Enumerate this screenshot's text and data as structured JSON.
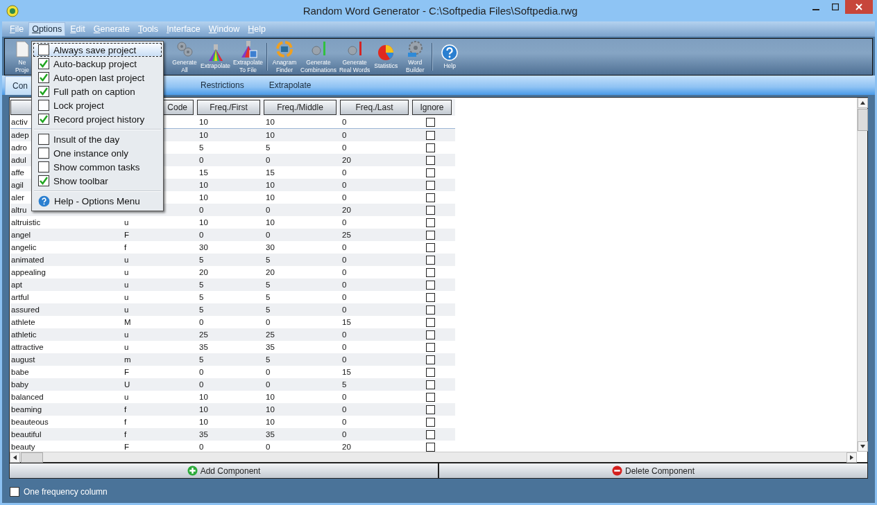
{
  "window": {
    "title": "Random Word Generator - C:\\Softpedia Files\\Softpedia.rwg"
  },
  "menubar": [
    {
      "label": "File",
      "selected": false
    },
    {
      "label": "Options",
      "selected": true
    },
    {
      "label": "Edit",
      "selected": false
    },
    {
      "label": "Generate",
      "selected": false
    },
    {
      "label": "Tools",
      "selected": false
    },
    {
      "label": "Interface",
      "selected": false
    },
    {
      "label": "Window",
      "selected": false
    },
    {
      "label": "Help",
      "selected": false
    }
  ],
  "toolbar": {
    "groups": [
      [
        {
          "label": "Ne\nProje",
          "kind": "document"
        },
        {
          "label": "Generate\nAll",
          "kind": "gears"
        },
        {
          "label": "Extrapolate",
          "kind": "prism"
        },
        {
          "label": "Extrapolate\nTo File",
          "kind": "prismfile"
        }
      ],
      [
        {
          "label": "Anagram\nFinder",
          "kind": "anagram"
        },
        {
          "label": "Generate\nCombinations",
          "kind": "combinations"
        },
        {
          "label": "Generate\nReal Words",
          "kind": "realwords"
        },
        {
          "label": "Statistics",
          "kind": "pie"
        },
        {
          "label": "Word\nBuilder",
          "kind": "builder"
        }
      ],
      [
        {
          "label": "Help",
          "kind": "help"
        }
      ]
    ]
  },
  "tabs": [
    {
      "label": "Con",
      "selected": true
    },
    {
      "label": "Restrictions",
      "selected": false
    },
    {
      "label": "Extrapolate",
      "selected": false
    }
  ],
  "options_menu": {
    "groups": [
      [
        {
          "label": "Always save project",
          "kind": "check",
          "checked": false,
          "selected": true
        },
        {
          "label": "Auto-backup project",
          "kind": "check",
          "checked": true,
          "selected": false
        },
        {
          "label": "Auto-open last project",
          "kind": "check",
          "checked": true,
          "selected": false
        },
        {
          "label": "Full path on caption",
          "kind": "check",
          "checked": true,
          "selected": false
        },
        {
          "label": "Lock project",
          "kind": "check",
          "checked": false,
          "selected": false
        },
        {
          "label": "Record project history",
          "kind": "check",
          "checked": true,
          "selected": false
        }
      ],
      [
        {
          "label": "Insult of the day",
          "kind": "check",
          "checked": false,
          "selected": false
        },
        {
          "label": "One instance only",
          "kind": "check",
          "checked": false,
          "selected": false
        },
        {
          "label": "Show common tasks",
          "kind": "check",
          "checked": false,
          "selected": false
        },
        {
          "label": "Show toolbar",
          "kind": "check",
          "checked": true,
          "selected": false
        }
      ],
      [
        {
          "label": "Help - Options Menu",
          "kind": "help",
          "selected": false
        }
      ]
    ]
  },
  "table": {
    "columns": [
      "Code",
      "Freq./First",
      "Freq./Middle",
      "Freq./Last",
      "Ignore"
    ],
    "rows": [
      {
        "word": "activ",
        "first": "10",
        "middle": "10",
        "last": "0",
        "ignored": false
      },
      {
        "word": "adep",
        "first": "10",
        "middle": "10",
        "last": "0",
        "ignored": false
      },
      {
        "word": "adro",
        "first": "5",
        "middle": "5",
        "last": "0",
        "ignored": false
      },
      {
        "word": "adul",
        "first": "0",
        "middle": "0",
        "last": "20",
        "ignored": false
      },
      {
        "word": "affe",
        "first": "15",
        "middle": "15",
        "last": "0",
        "ignored": false
      },
      {
        "word": "agil",
        "first": "10",
        "middle": "10",
        "last": "0",
        "ignored": false
      },
      {
        "word": "aler",
        "first": "10",
        "middle": "10",
        "last": "0",
        "ignored": false
      },
      {
        "word": "altru",
        "first": "0",
        "middle": "0",
        "last": "20",
        "ignored": false
      },
      {
        "word": "altruistic",
        "code": "u",
        "first": "10",
        "middle": "10",
        "last": "0",
        "ignored": false
      },
      {
        "word": "angel",
        "code": "F",
        "first": "0",
        "middle": "0",
        "last": "25",
        "ignored": false
      },
      {
        "word": "angelic",
        "code": "f",
        "first": "30",
        "middle": "30",
        "last": "0",
        "ignored": false
      },
      {
        "word": "animated",
        "code": "u",
        "first": "5",
        "middle": "5",
        "last": "0",
        "ignored": false
      },
      {
        "word": "appealing",
        "code": "u",
        "first": "20",
        "middle": "20",
        "last": "0",
        "ignored": false
      },
      {
        "word": "apt",
        "code": "u",
        "first": "5",
        "middle": "5",
        "last": "0",
        "ignored": false
      },
      {
        "word": "artful",
        "code": "u",
        "first": "5",
        "middle": "5",
        "last": "0",
        "ignored": false
      },
      {
        "word": "assured",
        "code": "u",
        "first": "5",
        "middle": "5",
        "last": "0",
        "ignored": false
      },
      {
        "word": "athlete",
        "code": "M",
        "first": "0",
        "middle": "0",
        "last": "15",
        "ignored": false
      },
      {
        "word": "athletic",
        "code": "u",
        "first": "25",
        "middle": "25",
        "last": "0",
        "ignored": false
      },
      {
        "word": "attractive",
        "code": "u",
        "first": "35",
        "middle": "35",
        "last": "0",
        "ignored": false
      },
      {
        "word": "august",
        "code": "m",
        "first": "5",
        "middle": "5",
        "last": "0",
        "ignored": false
      },
      {
        "word": "babe",
        "code": "F",
        "first": "0",
        "middle": "0",
        "last": "15",
        "ignored": false
      },
      {
        "word": "baby",
        "code": "U",
        "first": "0",
        "middle": "0",
        "last": "5",
        "ignored": false
      },
      {
        "word": "balanced",
        "code": "u",
        "first": "10",
        "middle": "10",
        "last": "0",
        "ignored": false
      },
      {
        "word": "beaming",
        "code": "f",
        "first": "10",
        "middle": "10",
        "last": "0",
        "ignored": false
      },
      {
        "word": "beauteous",
        "code": "f",
        "first": "10",
        "middle": "10",
        "last": "0",
        "ignored": false
      },
      {
        "word": "beautiful",
        "code": "f",
        "first": "35",
        "middle": "35",
        "last": "0",
        "ignored": false
      },
      {
        "word": "beauty",
        "code": "F",
        "first": "0",
        "middle": "0",
        "last": "20",
        "ignored": false
      }
    ]
  },
  "actions": [
    {
      "label": "Add Component",
      "kind": "add"
    },
    {
      "label": "Delete Component",
      "kind": "delete"
    }
  ],
  "footer": {
    "label": "One frequency column",
    "checked": false
  }
}
